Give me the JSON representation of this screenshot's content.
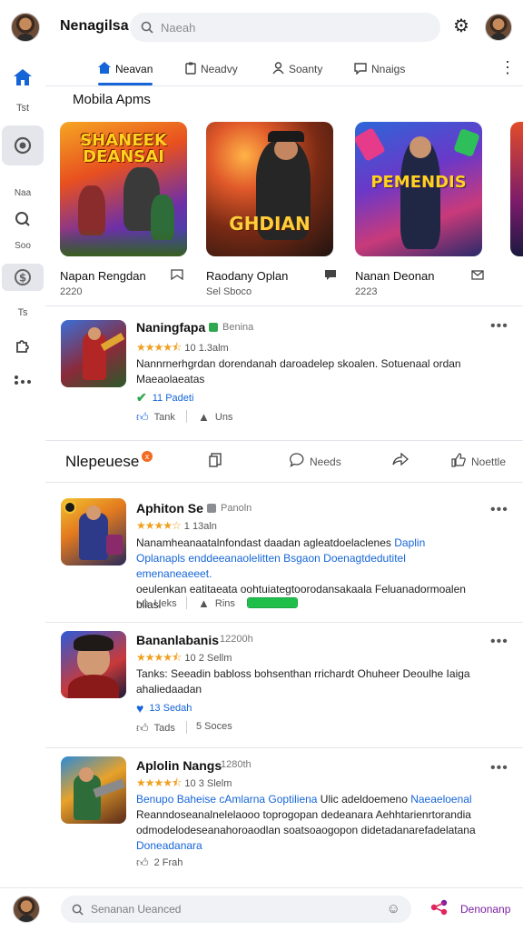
{
  "header": {
    "app_title": "Nenagilsa",
    "search_placeholder": "Naeah"
  },
  "rail": {
    "label_1": "Tst",
    "label_2": "Naa",
    "label_3": "Soo",
    "label_4": "Ts"
  },
  "tabs": [
    {
      "label": "Neavan",
      "icon": "home-icon",
      "active": true
    },
    {
      "label": "Neadvy",
      "icon": "clipboard-icon"
    },
    {
      "label": "Soanty",
      "icon": "user-icon"
    },
    {
      "label": "Nnaigs",
      "icon": "chat-icon"
    }
  ],
  "featured": {
    "title": "Mobila Apms",
    "cards": [
      {
        "name": "Napan Rengdan",
        "sub": "2220",
        "art_title": "SHANEEK DEANSAI",
        "icon": "bookmark-icon"
      },
      {
        "name": "Raodany Oplan",
        "sub": "Sel Sboco",
        "art_title": "GHDIAN",
        "icon": "chat-icon"
      },
      {
        "name": "Nanan Deonan",
        "sub": "2223",
        "art_title": "PEMENDIS",
        "icon": "mail-icon"
      }
    ]
  },
  "post1": {
    "title": "Naningfapa",
    "tag": "Benina",
    "rating_text": "10  1.3alm",
    "stars": 4.5,
    "text": "Nannrnerhgrdan dorendanah daroadelep skoalen. Sotuenaal ordan Maeaolaeatas",
    "badge": "11  Padeti",
    "action_like": "Tank",
    "action_share": "Uns"
  },
  "reactions": {
    "title": "Nlepeuese",
    "badge": "x",
    "btn_2": "Needs",
    "btn_4": "Noettle"
  },
  "post2": {
    "title": "Aphiton Se",
    "tag": "Panoln",
    "rating_text": "1  13aln",
    "stars": 4,
    "text_a": "Nanamheanaatalnfondast daadan agleatdoelaclenes ",
    "text_link_a": "Daplin",
    "text_link_b": "Oplanapls enddeeanaolelitten Bsgaon Doenagtdedutitel emenaneaeeet.",
    "text_b": "oeulenkan eatitaeata oohtuiategtoorodansakaala Feluanadormoalen",
    "text_c": "bliasl",
    "action_like": "Ueks",
    "action_share": "Rins",
    "progress": 1.0
  },
  "post3": {
    "title": "Bananlabanis",
    "time": "12200h",
    "rating_text": "10  2 Sellm",
    "stars": 4.5,
    "text": "Tanks: Seeadin babloss bohsenthan rrichardt Ohuheer Deoulhe Iaiga ahaliedaadan",
    "badge": "13  Sedah",
    "action_like": "Tads",
    "action_share": "5  Soces"
  },
  "post4": {
    "title": "Aplolin Nangs",
    "time": "1280th",
    "rating_text": "10  3 Slelm",
    "stars": 4.5,
    "text_link_a": "Benupo Baheise cAmlarna Goptiliena",
    "text_a": " Ulic adeldoemeno ",
    "text_link_b": "Naeaeloenal",
    "text_b": "Reanndoseanalnelelaooo toprogopan dedeanara Aehhtarienrtorandia odmodelodeseanahoroaodlan soatsoaogopon didetadanarefadelatana ",
    "text_link_c": "Doneadanara",
    "action_like": "2  Frah"
  },
  "bottom": {
    "search_placeholder": "Senanan Ueanced",
    "label": "Denonanp"
  }
}
